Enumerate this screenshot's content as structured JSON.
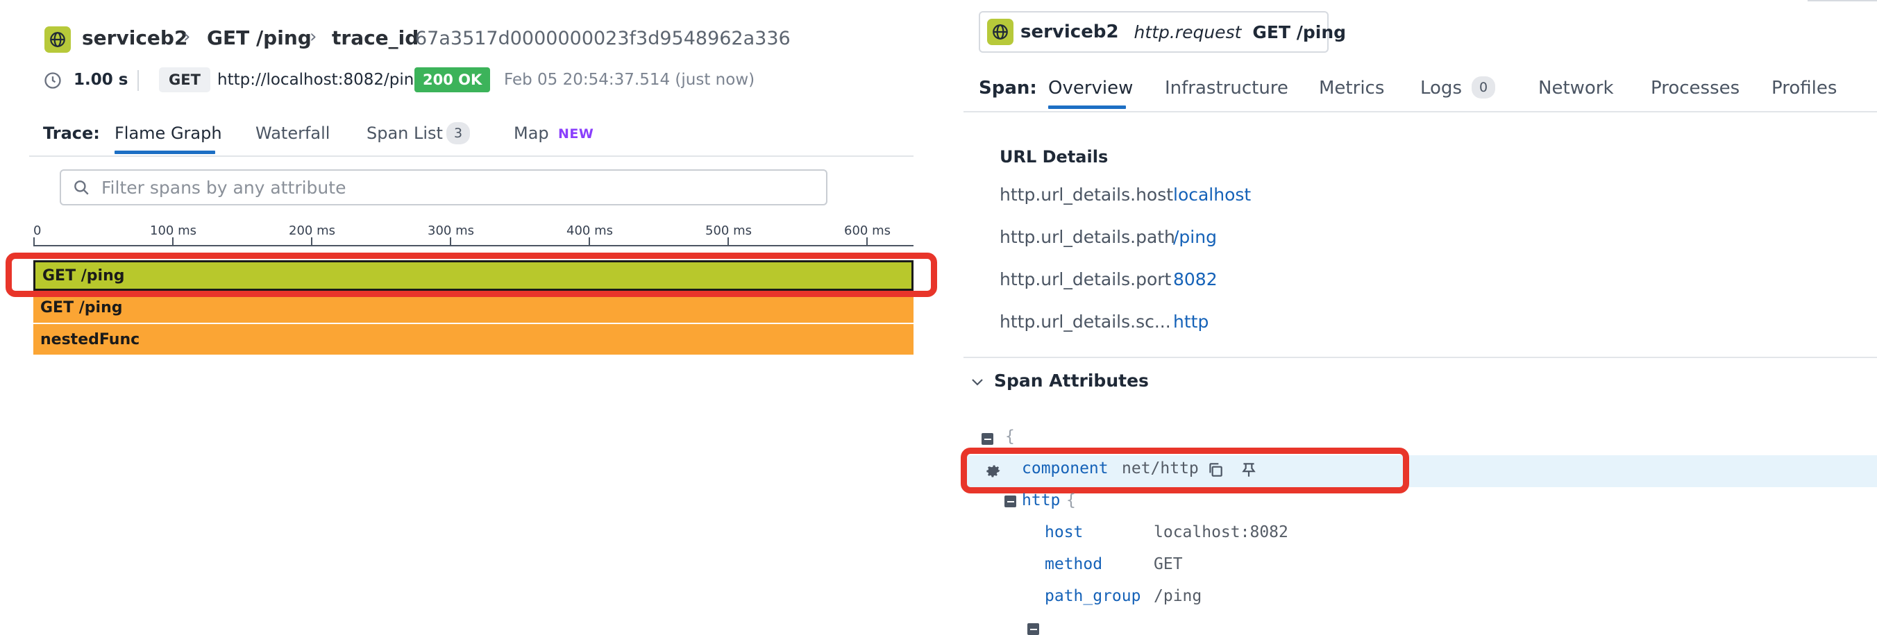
{
  "header": {
    "service": "serviceb2",
    "resource": "GET /ping",
    "trace_id_label": "trace_id",
    "trace_id": "67a3517d0000000023f3d9548962a336"
  },
  "meta": {
    "duration": "1.00 s",
    "method": "GET",
    "url": "http://localhost:8082/ping",
    "status": "200 OK",
    "timestamp": "Feb 05 20:54:37.514 (just now)"
  },
  "trace_tabs": {
    "label": "Trace:",
    "items": [
      {
        "label": "Flame Graph"
      },
      {
        "label": "Waterfall"
      },
      {
        "label": "Span List",
        "count": "3"
      },
      {
        "label": "Map",
        "badge": "NEW"
      }
    ]
  },
  "filter": {
    "placeholder": "Filter spans by any attribute",
    "value": ""
  },
  "timeline": {
    "ticks": [
      "0",
      "100 ms",
      "200 ms",
      "300 ms",
      "400 ms",
      "500 ms",
      "600 ms"
    ]
  },
  "spans": [
    {
      "name": "GET /ping",
      "color": "#b8c82c"
    },
    {
      "name": "GET /ping",
      "color": "#fba534"
    },
    {
      "name": "nestedFunc",
      "color": "#fba534"
    }
  ],
  "span_header": {
    "service": "serviceb2",
    "operation": "http.request",
    "resource": "GET /ping"
  },
  "span_tabs": {
    "label": "Span:",
    "items": [
      {
        "label": "Overview"
      },
      {
        "label": "Infrastructure"
      },
      {
        "label": "Metrics"
      },
      {
        "label": "Logs",
        "count": "0"
      },
      {
        "label": "Network"
      },
      {
        "label": "Processes"
      },
      {
        "label": "Profiles"
      }
    ]
  },
  "url_details": {
    "title": "URL Details",
    "rows": [
      {
        "key": "http.url_details.host",
        "value": "localhost"
      },
      {
        "key": "http.url_details.path",
        "value": "/ping"
      },
      {
        "key": "http.url_details.port",
        "value": "8082"
      },
      {
        "key": "http.url_details.sc...",
        "value": "http"
      }
    ]
  },
  "span_attributes": {
    "title": "Span Attributes",
    "open_brace": "{",
    "component_key": "component",
    "component_value": "net/http",
    "http_key": "http",
    "http_open": "{",
    "http_fields": [
      {
        "key": "host",
        "value": "localhost:8082"
      },
      {
        "key": "method",
        "value": "GET"
      },
      {
        "key": "path_group",
        "value": "/ping"
      }
    ]
  },
  "colors": {
    "accent": "#1d6fc4",
    "service_icon": "#b7c93a",
    "status_ok": "#3cb35a",
    "highlight": "#e8352a",
    "new_badge": "#8a3ffc"
  },
  "icons": [
    "globe-icon",
    "chevron-right-icon",
    "clock-icon",
    "search-icon",
    "kebab-menu-icon",
    "chevron-down-icon",
    "gear-icon",
    "copy-icon",
    "pin-icon",
    "collapse-icon"
  ]
}
